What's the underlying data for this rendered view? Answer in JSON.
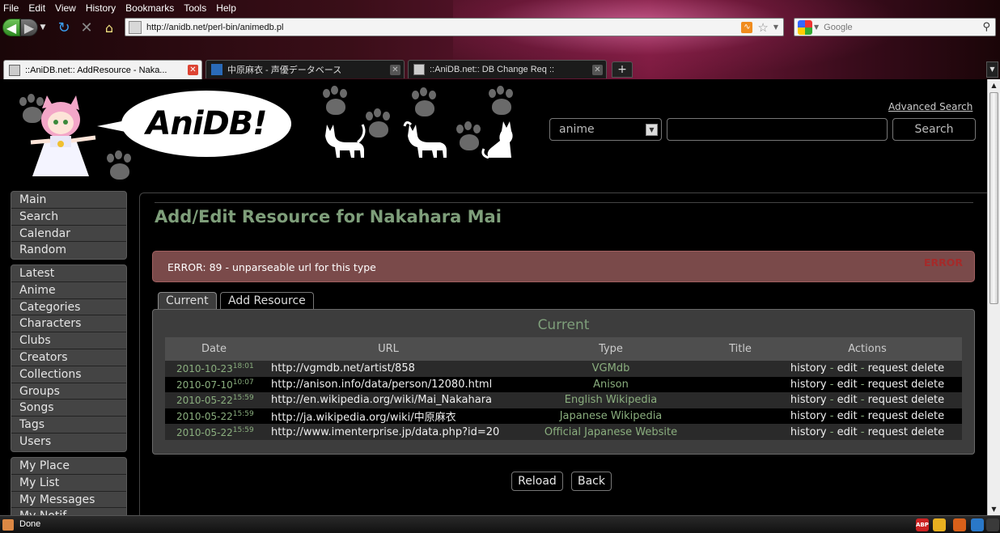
{
  "menu": [
    "File",
    "Edit",
    "View",
    "History",
    "Bookmarks",
    "Tools",
    "Help"
  ],
  "address_bar": {
    "url": "http://anidb.net/perl-bin/animedb.pl"
  },
  "search_bar": {
    "engine": "Google"
  },
  "tabs": [
    {
      "label": "::AniDB.net:: AddResource - Naka...",
      "active": true
    },
    {
      "label": "中原麻衣 - 声優データベース",
      "active": false
    },
    {
      "label": "::AniDB.net:: DB Change Req ::",
      "active": false
    }
  ],
  "new_tab_label": "+",
  "header": {
    "logo_text": "AniDB!",
    "advanced_search": "Advanced Search",
    "category_value": "anime",
    "query_value": "",
    "search_button": "Search"
  },
  "sidebar": {
    "group1": [
      "Main",
      "Search",
      "Calendar",
      "Random"
    ],
    "group2": [
      "Latest",
      "Anime",
      "Categories",
      "Characters",
      "Clubs",
      "Creators",
      "Collections",
      "Groups",
      "Songs",
      "Tags",
      "Users"
    ],
    "group3": [
      "My Place",
      "My List",
      "My Messages",
      "My Notif..."
    ]
  },
  "page": {
    "heading": "Add/Edit Resource for Nakahara Mai",
    "error_message": "ERROR: 89 - unparseable url for this type",
    "error_badge": "ERROR",
    "tab_current": "Current",
    "tab_add": "Add Resource",
    "panel_title": "Current",
    "columns": {
      "date": "Date",
      "url": "URL",
      "type": "Type",
      "title": "Title",
      "actions": "Actions"
    },
    "rows": [
      {
        "date": "2010-10-23",
        "time": "18:01",
        "url": "http://vgmdb.net/artist/858",
        "type": "VGMdb",
        "title": ""
      },
      {
        "date": "2010-07-10",
        "time": "10:07",
        "url": "http://anison.info/data/person/12080.html",
        "type": "Anison",
        "title": ""
      },
      {
        "date": "2010-05-22",
        "time": "15:59",
        "url": "http://en.wikipedia.org/wiki/Mai_Nakahara",
        "type": "English Wikipedia",
        "title": ""
      },
      {
        "date": "2010-05-22",
        "time": "15:59",
        "url": "http://ja.wikipedia.org/wiki/中原麻衣",
        "type": "Japanese Wikipedia",
        "title": ""
      },
      {
        "date": "2010-05-22",
        "time": "15:59",
        "url": "http://www.imenterprise.jp/data.php?id=20",
        "type": "Official Japanese Website",
        "title": ""
      }
    ],
    "actions": {
      "history": "history",
      "edit": "edit",
      "request_delete": "request delete",
      "sep": "-"
    },
    "reload_button": "Reload",
    "back_button": "Back"
  },
  "status": {
    "text": "Done",
    "tray": [
      "ABP"
    ]
  }
}
